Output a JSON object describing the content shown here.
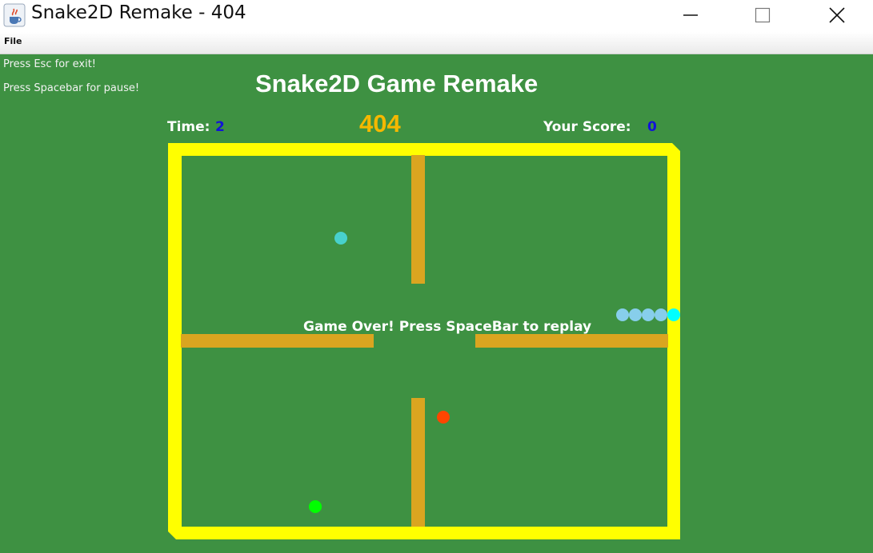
{
  "window": {
    "title": "Snake2D Remake - 404",
    "icon": "java-cup-icon",
    "controls": [
      "minimize-icon",
      "maximize-icon",
      "close-icon"
    ]
  },
  "menu": {
    "file_label": "File"
  },
  "game": {
    "hints": {
      "exit": "Press Esc for exit!",
      "pause": "Press Spacebar for pause!"
    },
    "title": "Snake2D Game Remake",
    "hud": {
      "time_label": "Time:",
      "time_value": "2",
      "level": "404",
      "score_label": "Your Score:",
      "score_value": "0"
    },
    "message": "Game Over! Press SpaceBar to replay",
    "colors": {
      "background": "#3e9142",
      "border": "#ffff00",
      "walls": "#daa520",
      "snake_body": "#87ceeb",
      "snake_head": "#00ffff",
      "food_cyan": "#48d1cc",
      "food_red": "#ff4500",
      "food_green": "#00ff00",
      "level_text": "#f5b800",
      "hud_value_text": "#1212d8"
    }
  }
}
